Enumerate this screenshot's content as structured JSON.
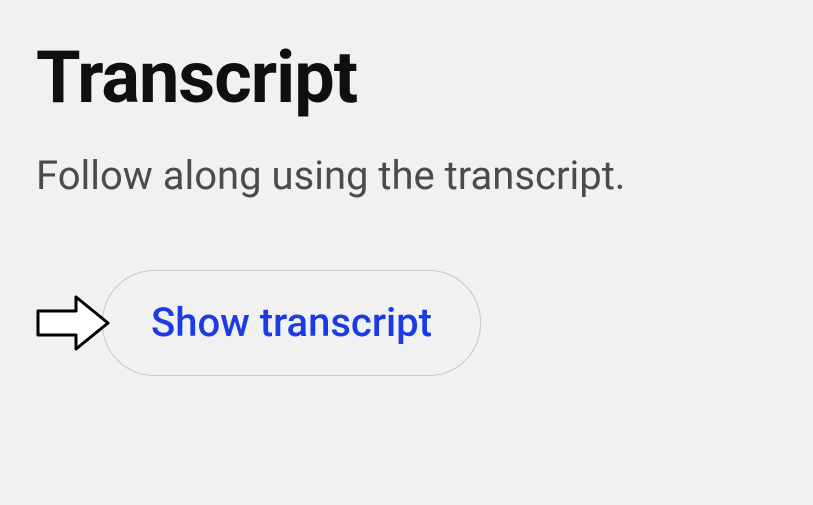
{
  "section": {
    "title": "Transcript",
    "subtitle": "Follow along using the transcript."
  },
  "button": {
    "label": "Show transcript"
  }
}
